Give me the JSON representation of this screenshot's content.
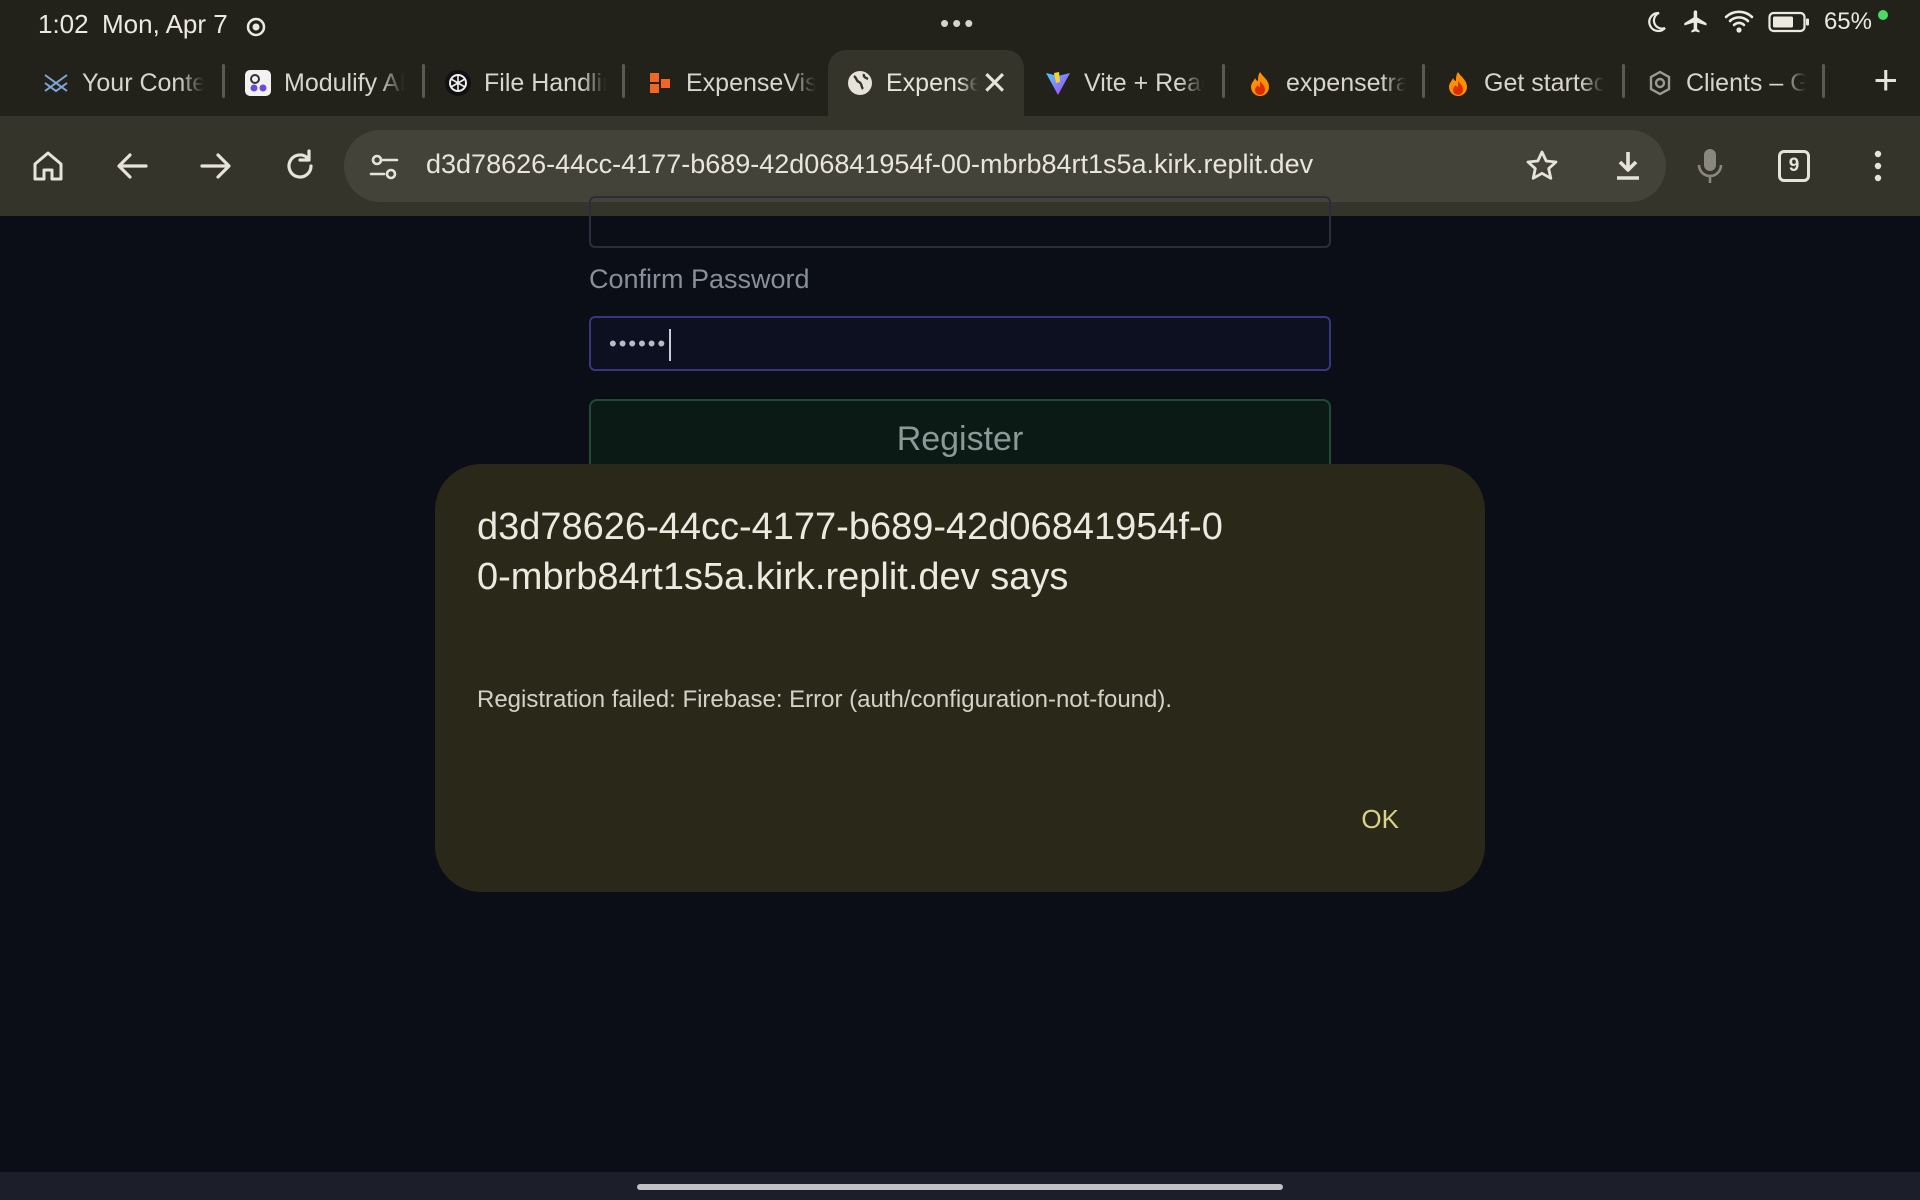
{
  "status_bar": {
    "time": "1:02",
    "date": "Mon, Apr 7",
    "more_dots": "•••",
    "battery": "65%"
  },
  "tabs": [
    {
      "label": "Your Conte",
      "icon": "layers-icon",
      "active": false
    },
    {
      "label": "Modulify AI",
      "icon": "modulify-icon",
      "active": false
    },
    {
      "label": "File Handlin",
      "icon": "openai-icon",
      "active": false
    },
    {
      "label": "ExpenseVis",
      "icon": "expensevis-icon",
      "active": false
    },
    {
      "label": "Expense",
      "icon": "globe-icon",
      "active": true
    },
    {
      "label": "Vite + Reac",
      "icon": "vite-icon",
      "active": false
    },
    {
      "label": "expensetra",
      "icon": "firebase-icon",
      "active": false
    },
    {
      "label": "Get startec",
      "icon": "firebase-icon",
      "active": false
    },
    {
      "label": "Clients – G",
      "icon": "gear-icon",
      "active": false
    }
  ],
  "toolbar": {
    "url": "d3d78626-44cc-4177-b689-42d06841954f-00-mbrb84rt1s5a.kirk.replit.dev",
    "tab_count": "9"
  },
  "page": {
    "confirm_label": "Confirm Password",
    "confirm_value": "••••••",
    "register_label": "Register"
  },
  "dialog": {
    "title": "d3d78626-44cc-4177-b689-42d06841954f-00-mbrb84rt1s5a.kirk.replit.dev says",
    "message": "Registration failed: Firebase: Error (auth/configuration-not-found).",
    "ok_label": "OK"
  },
  "colors": {
    "chrome_bg": "#22221a",
    "toolbar_bg": "#34342a",
    "page_bg": "#0b0e17",
    "dialog_bg": "#2a2819",
    "ok_accent": "#d9d28a"
  }
}
